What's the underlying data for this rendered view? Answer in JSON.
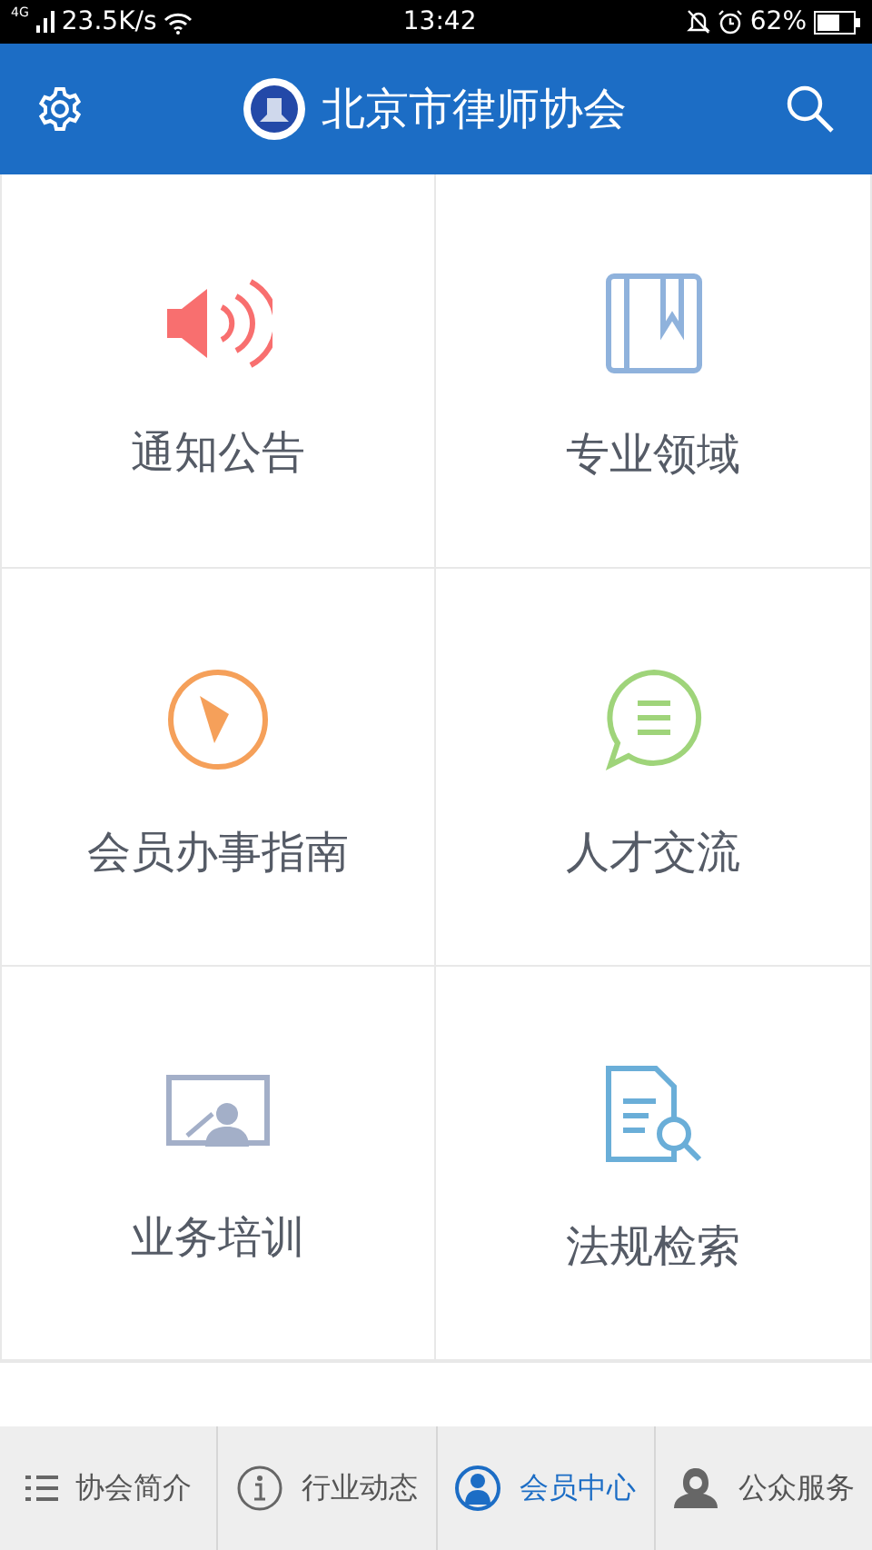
{
  "status_bar": {
    "network": "4G",
    "speed": "23.5K/s",
    "time": "13:42",
    "battery": "62%"
  },
  "header": {
    "title": "北京市律师协会"
  },
  "tiles": [
    {
      "label": "通知公告"
    },
    {
      "label": "专业领域"
    },
    {
      "label": "会员办事指南"
    },
    {
      "label": "人才交流"
    },
    {
      "label": "业务培训"
    },
    {
      "label": "法规检索"
    }
  ],
  "bottom_nav": [
    {
      "label": "协会简介",
      "selected": false
    },
    {
      "label": "行业动态",
      "selected": false
    },
    {
      "label": "会员中心",
      "selected": true
    },
    {
      "label": "公众服务",
      "selected": false
    }
  ]
}
